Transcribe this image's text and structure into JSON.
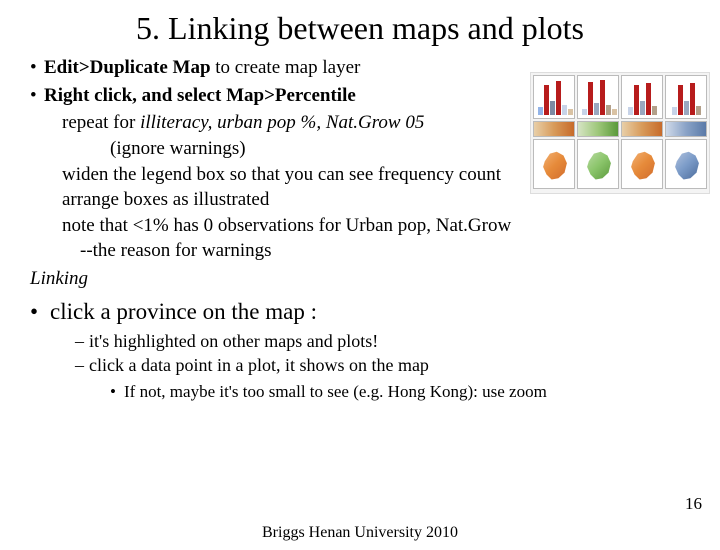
{
  "title": "5. Linking between maps and plots",
  "b1": {
    "bold1": "Edit>Duplicate Map",
    "rest1": " to create map layer"
  },
  "b2": {
    "bold2": "Right click, and select Map>Percentile"
  },
  "s1a": "repeat for ",
  "s1b": "illiteracy, urban pop %, Nat.Grow 05",
  "s2": "(ignore warnings)",
  "s3": "widen the legend box so that you can see frequency count",
  "s4": "arrange boxes as illustrated",
  "s5": "note that  <1% has 0 observations for Urban pop, Nat.Grow",
  "s6": "--the reason for warnings",
  "linking": "Linking",
  "big": "click a province on the map :",
  "d1": "it's highlighted on other maps and plots!",
  "d2": "click a data point in a plot, it shows on the map",
  "sb": "If not, maybe it's too small to see (e.g. Hong Kong):  use zoom",
  "pagenum": "16",
  "footer": "Briggs  Henan University 2010"
}
